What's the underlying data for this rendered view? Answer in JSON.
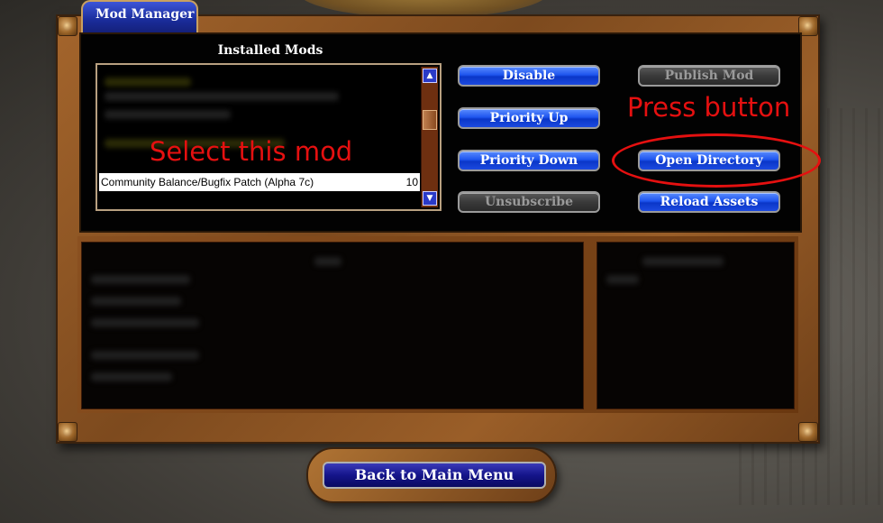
{
  "window": {
    "tab_title": "Mod Manager"
  },
  "installed_mods": {
    "title": "Installed Mods",
    "selected_item": {
      "name": "Community Balance/Bugfix Patch (Alpha 7c)",
      "number": "10"
    },
    "scroll_up_icon": "arrow-up-icon",
    "scroll_down_icon": "arrow-down-icon"
  },
  "buttons": {
    "disable": "Disable",
    "priority_up": "Priority Up",
    "priority_down": "Priority Down",
    "unsubscribe": "Unsubscribe",
    "publish_mod": "Publish Mod",
    "open_directory": "Open Directory",
    "reload_assets": "Reload Assets",
    "back": "Back to Main Menu"
  },
  "annotations": {
    "select_mod": "Select this mod",
    "press_button": "Press button"
  },
  "colors": {
    "button_blue": "#1e55ee",
    "frame_bronze": "#9a5e28",
    "annotation_red": "#e51010"
  }
}
